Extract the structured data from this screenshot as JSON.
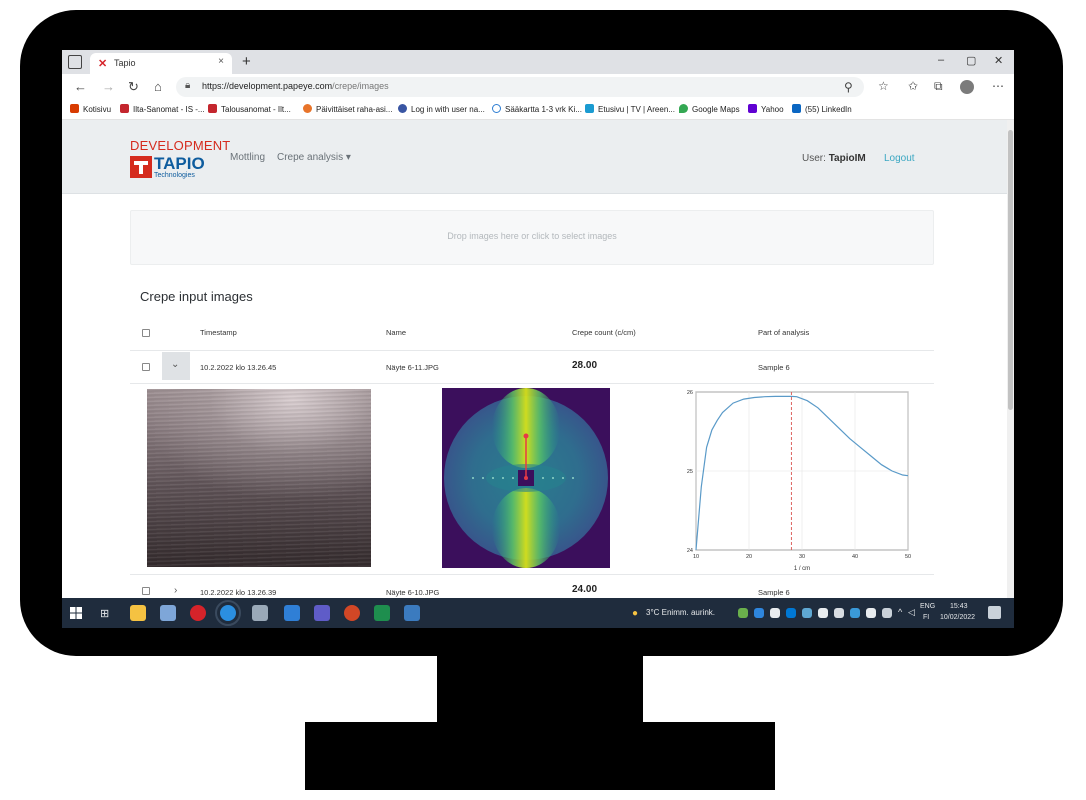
{
  "browser": {
    "tab_title": "Tapio",
    "tab_close": "×",
    "new_tab": "+",
    "url_host": "https://development.papeye.com",
    "url_path": "/crepe/images",
    "window_controls": [
      "–",
      "▢",
      "✕"
    ]
  },
  "bookmarks": [
    {
      "label": "Kotisivu",
      "color": "#d83b01"
    },
    {
      "label": "Ilta-Sanomat - IS -...",
      "color": "#c4262e"
    },
    {
      "label": "Talousanomat - Ilt...",
      "color": "#c4262e"
    },
    {
      "label": "Päivittäiset raha-asi...",
      "color": "#e8742a"
    },
    {
      "label": "Log in with user na...",
      "color": "#3955a3"
    },
    {
      "label": "Sääkartta 1-3 vrk Ki...",
      "color": "#2d7dd2"
    },
    {
      "label": "Etusivu | TV | Areen...",
      "color": "#1b9bd1"
    },
    {
      "label": "Google Maps",
      "color": "#34a853"
    },
    {
      "label": "Yahoo",
      "color": "#6001d2"
    },
    {
      "label": "(55) LinkedIn",
      "color": "#0a66c2"
    }
  ],
  "header": {
    "brand_top": "DEVELOPMENT",
    "brand_name": "TAPIO",
    "brand_sub": "Technologies",
    "nav": [
      "Mottling",
      "Crepe analysis ▾"
    ],
    "user_prefix": "User:",
    "user_name": "TapioIM",
    "logout": "Logout"
  },
  "dropzone": {
    "text": "Drop images here or click to select images"
  },
  "section_title": "Crepe input images",
  "table": {
    "columns": [
      "Timestamp",
      "Name",
      "Crepe count (c/cm)",
      "Part of analysis"
    ],
    "rows": [
      {
        "timestamp": "10.2.2022 klo 13.26.45",
        "name": "Näyte 6-11.JPG",
        "crepe_count": "28.00",
        "analysis": "Sample 6",
        "expanded": true
      },
      {
        "timestamp": "10.2.2022 klo 13.26.39",
        "name": "Näyte 6-10.JPG",
        "crepe_count": "24.00",
        "analysis": "Sample 6",
        "expanded": false
      }
    ]
  },
  "chart_data": {
    "type": "line",
    "x": [
      10,
      11,
      12,
      13,
      14,
      15,
      17,
      19,
      21,
      23,
      25,
      27,
      28,
      29,
      31,
      33,
      35,
      37,
      39,
      41,
      43,
      45,
      47,
      49,
      50
    ],
    "series": [
      {
        "values": [
          0,
          4.0,
          6.5,
          7.6,
          8.2,
          8.7,
          9.3,
          9.55,
          9.65,
          9.7,
          9.72,
          9.73,
          9.72,
          9.7,
          9.45,
          9.0,
          8.35,
          7.7,
          7.05,
          6.5,
          5.95,
          5.4,
          5.0,
          4.75,
          4.7
        ]
      }
    ],
    "title": "",
    "xlabel": "1 / cm",
    "ylabel": "",
    "xlim": [
      10,
      50
    ],
    "ylim": [
      0,
      10
    ],
    "xticks": [
      "10",
      "20",
      "30",
      "40",
      "50"
    ],
    "yticks": [
      "24",
      "25",
      "26"
    ],
    "grid": true,
    "marker_x": 28,
    "line_color": "#5a9ac8",
    "marker_color": "#d9534f"
  },
  "taskbar": {
    "weather": "3°C  Enimm. aurink.",
    "lang_top": "ENG",
    "lang_bottom": "FI",
    "time": "15:43",
    "date": "10/02/2022"
  }
}
